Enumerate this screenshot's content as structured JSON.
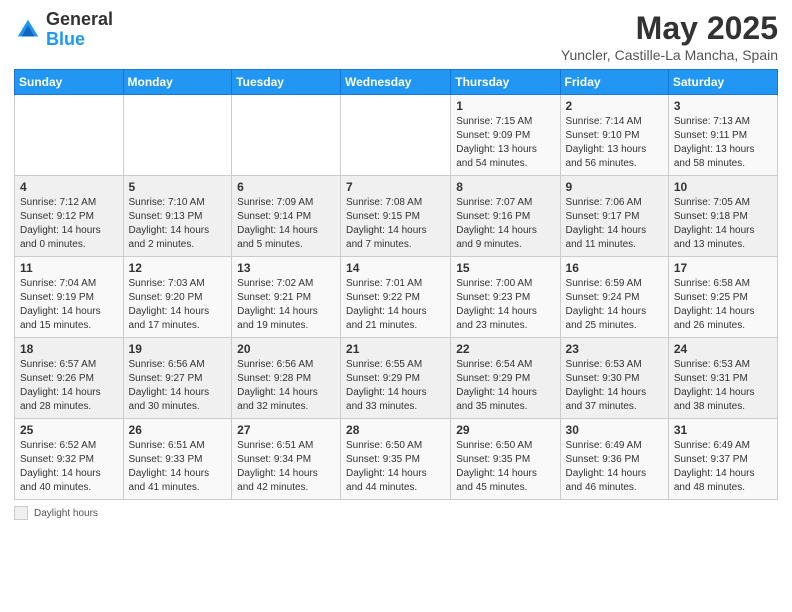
{
  "logo": {
    "general": "General",
    "blue": "Blue"
  },
  "header": {
    "title": "May 2025",
    "subtitle": "Yuncler, Castille-La Mancha, Spain"
  },
  "days_header": [
    "Sunday",
    "Monday",
    "Tuesday",
    "Wednesday",
    "Thursday",
    "Friday",
    "Saturday"
  ],
  "weeks": [
    [
      {
        "day": "",
        "info": ""
      },
      {
        "day": "",
        "info": ""
      },
      {
        "day": "",
        "info": ""
      },
      {
        "day": "",
        "info": ""
      },
      {
        "day": "1",
        "info": "Sunrise: 7:15 AM\nSunset: 9:09 PM\nDaylight: 13 hours\nand 54 minutes."
      },
      {
        "day": "2",
        "info": "Sunrise: 7:14 AM\nSunset: 9:10 PM\nDaylight: 13 hours\nand 56 minutes."
      },
      {
        "day": "3",
        "info": "Sunrise: 7:13 AM\nSunset: 9:11 PM\nDaylight: 13 hours\nand 58 minutes."
      }
    ],
    [
      {
        "day": "4",
        "info": "Sunrise: 7:12 AM\nSunset: 9:12 PM\nDaylight: 14 hours\nand 0 minutes."
      },
      {
        "day": "5",
        "info": "Sunrise: 7:10 AM\nSunset: 9:13 PM\nDaylight: 14 hours\nand 2 minutes."
      },
      {
        "day": "6",
        "info": "Sunrise: 7:09 AM\nSunset: 9:14 PM\nDaylight: 14 hours\nand 5 minutes."
      },
      {
        "day": "7",
        "info": "Sunrise: 7:08 AM\nSunset: 9:15 PM\nDaylight: 14 hours\nand 7 minutes."
      },
      {
        "day": "8",
        "info": "Sunrise: 7:07 AM\nSunset: 9:16 PM\nDaylight: 14 hours\nand 9 minutes."
      },
      {
        "day": "9",
        "info": "Sunrise: 7:06 AM\nSunset: 9:17 PM\nDaylight: 14 hours\nand 11 minutes."
      },
      {
        "day": "10",
        "info": "Sunrise: 7:05 AM\nSunset: 9:18 PM\nDaylight: 14 hours\nand 13 minutes."
      }
    ],
    [
      {
        "day": "11",
        "info": "Sunrise: 7:04 AM\nSunset: 9:19 PM\nDaylight: 14 hours\nand 15 minutes."
      },
      {
        "day": "12",
        "info": "Sunrise: 7:03 AM\nSunset: 9:20 PM\nDaylight: 14 hours\nand 17 minutes."
      },
      {
        "day": "13",
        "info": "Sunrise: 7:02 AM\nSunset: 9:21 PM\nDaylight: 14 hours\nand 19 minutes."
      },
      {
        "day": "14",
        "info": "Sunrise: 7:01 AM\nSunset: 9:22 PM\nDaylight: 14 hours\nand 21 minutes."
      },
      {
        "day": "15",
        "info": "Sunrise: 7:00 AM\nSunset: 9:23 PM\nDaylight: 14 hours\nand 23 minutes."
      },
      {
        "day": "16",
        "info": "Sunrise: 6:59 AM\nSunset: 9:24 PM\nDaylight: 14 hours\nand 25 minutes."
      },
      {
        "day": "17",
        "info": "Sunrise: 6:58 AM\nSunset: 9:25 PM\nDaylight: 14 hours\nand 26 minutes."
      }
    ],
    [
      {
        "day": "18",
        "info": "Sunrise: 6:57 AM\nSunset: 9:26 PM\nDaylight: 14 hours\nand 28 minutes."
      },
      {
        "day": "19",
        "info": "Sunrise: 6:56 AM\nSunset: 9:27 PM\nDaylight: 14 hours\nand 30 minutes."
      },
      {
        "day": "20",
        "info": "Sunrise: 6:56 AM\nSunset: 9:28 PM\nDaylight: 14 hours\nand 32 minutes."
      },
      {
        "day": "21",
        "info": "Sunrise: 6:55 AM\nSunset: 9:29 PM\nDaylight: 14 hours\nand 33 minutes."
      },
      {
        "day": "22",
        "info": "Sunrise: 6:54 AM\nSunset: 9:29 PM\nDaylight: 14 hours\nand 35 minutes."
      },
      {
        "day": "23",
        "info": "Sunrise: 6:53 AM\nSunset: 9:30 PM\nDaylight: 14 hours\nand 37 minutes."
      },
      {
        "day": "24",
        "info": "Sunrise: 6:53 AM\nSunset: 9:31 PM\nDaylight: 14 hours\nand 38 minutes."
      }
    ],
    [
      {
        "day": "25",
        "info": "Sunrise: 6:52 AM\nSunset: 9:32 PM\nDaylight: 14 hours\nand 40 minutes."
      },
      {
        "day": "26",
        "info": "Sunrise: 6:51 AM\nSunset: 9:33 PM\nDaylight: 14 hours\nand 41 minutes."
      },
      {
        "day": "27",
        "info": "Sunrise: 6:51 AM\nSunset: 9:34 PM\nDaylight: 14 hours\nand 42 minutes."
      },
      {
        "day": "28",
        "info": "Sunrise: 6:50 AM\nSunset: 9:35 PM\nDaylight: 14 hours\nand 44 minutes."
      },
      {
        "day": "29",
        "info": "Sunrise: 6:50 AM\nSunset: 9:35 PM\nDaylight: 14 hours\nand 45 minutes."
      },
      {
        "day": "30",
        "info": "Sunrise: 6:49 AM\nSunset: 9:36 PM\nDaylight: 14 hours\nand 46 minutes."
      },
      {
        "day": "31",
        "info": "Sunrise: 6:49 AM\nSunset: 9:37 PM\nDaylight: 14 hours\nand 48 minutes."
      }
    ]
  ],
  "footer": {
    "daylight_label": "Daylight hours"
  }
}
